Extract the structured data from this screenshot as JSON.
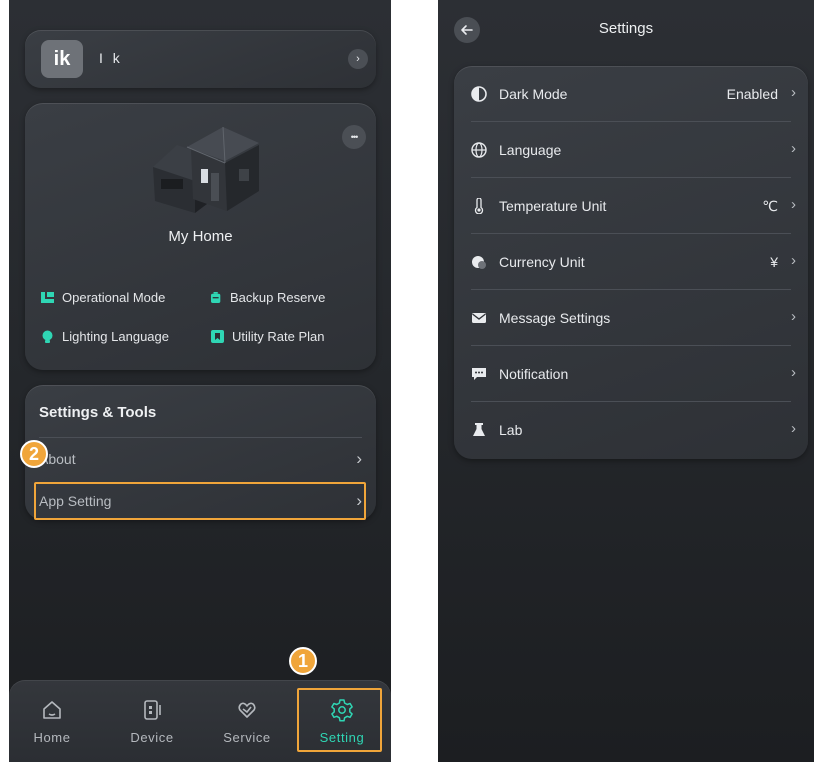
{
  "left_screen": {
    "profile": {
      "avatar_text": "ik",
      "name": "I k"
    },
    "home": {
      "more_label": "•••",
      "title": "My Home",
      "features": [
        {
          "label": "Operational Mode",
          "icon": "operational-mode-icon"
        },
        {
          "label": "Backup Reserve",
          "icon": "battery-icon"
        },
        {
          "label": "Lighting Language",
          "icon": "bulb-icon"
        },
        {
          "label": "Utility Rate Plan",
          "icon": "rate-plan-icon"
        }
      ]
    },
    "tools": {
      "title": "Settings & Tools",
      "items": [
        {
          "label": "About"
        },
        {
          "label": "App Setting"
        }
      ]
    },
    "nav": [
      {
        "label": "Home",
        "icon": "home-icon"
      },
      {
        "label": "Device",
        "icon": "device-icon"
      },
      {
        "label": "Service",
        "icon": "service-icon"
      },
      {
        "label": "Setting",
        "icon": "gear-icon"
      }
    ],
    "steps": [
      "1",
      "2"
    ]
  },
  "right_screen": {
    "title": "Settings",
    "items": [
      {
        "label": "Dark Mode",
        "value": "Enabled",
        "icon": "contrast-icon"
      },
      {
        "label": "Language",
        "value": "",
        "icon": "globe-icon"
      },
      {
        "label": "Temperature Unit",
        "value": "℃",
        "icon": "thermometer-icon"
      },
      {
        "label": "Currency Unit",
        "value": "¥",
        "icon": "coin-icon"
      },
      {
        "label": "Message Settings",
        "value": "",
        "icon": "mail-icon"
      },
      {
        "label": "Notification",
        "value": "",
        "icon": "chat-bubble-icon"
      },
      {
        "label": "Lab",
        "value": "",
        "icon": "flask-icon"
      }
    ]
  },
  "colors": {
    "accent_teal": "#2fd6b4",
    "highlight_orange": "#f0a53a",
    "background": "#25282c",
    "card": "#34373c"
  }
}
